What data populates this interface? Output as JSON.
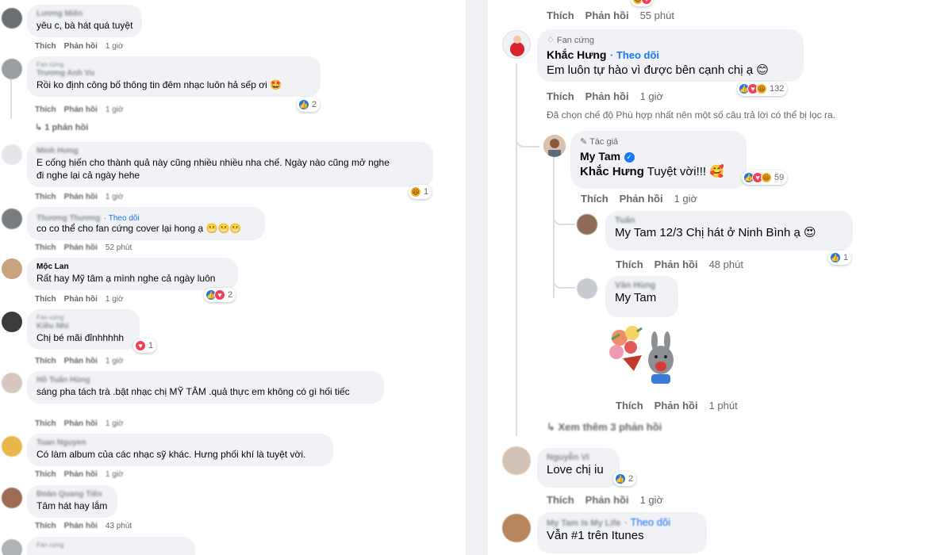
{
  "left": {
    "comments": [
      {
        "name": "Lương Miên",
        "text": "yêu c, bà hát quá tuyệt",
        "like": "Thích",
        "reply": "Phản hồi",
        "time": "1 giờ"
      },
      {
        "badge": "Fan cứng",
        "name": "Trương Anh Vu",
        "text": "Rồi ko định công bố thông tin đêm nhạc luôn hả sếp ơi 🤩",
        "reactions": "2",
        "like": "Thích",
        "reply": "Phản hồi",
        "time": "1 giờ",
        "replies": "1 phản hồi"
      },
      {
        "name": "Minh Hưng",
        "text_line1": "E cống hiến cho thành quả này cũng nhiều nhiều nha chế. Ngày nào cũng mở nghe",
        "text_line2": "đi nghe lại cả ngày hehe",
        "reactions": "1",
        "like": "Thích",
        "reply": "Phản hồi",
        "time": "1 giờ"
      },
      {
        "name": "Thương Thương",
        "follow": "Theo dõi",
        "text": "co co thể cho fan cứng cover lại hong ạ 😬😬😬",
        "like": "Thích",
        "reply": "Phản hồi",
        "time": "52 phút"
      },
      {
        "name": "Mộc Lan",
        "text": "Rất hay Mỹ tâm ạ mình nghe cả ngày luôn",
        "reactions": "2",
        "like": "Thích",
        "reply": "Phản hồi",
        "time": "1 giờ"
      },
      {
        "badge": "Fan cứng",
        "name": "Kiều Nhi",
        "text": "Chị bé mãi đỉnhhhhh",
        "reactions": "1",
        "like": "Thích",
        "reply": "Phản hồi",
        "time": "1 giờ"
      },
      {
        "name": "Hồ Tuấn Hùng",
        "text": "sáng pha tách trà .bật nhạc chị MỸ TÂM .quả thực em không có gì hối tiếc",
        "like": "Thích",
        "reply": "Phản hồi",
        "time": "1 giờ"
      },
      {
        "name": "Tuan Nguyen",
        "text": "Có làm album của các nhạc sỹ khác. Hưng phối khí là tuyệt vời.",
        "like": "Thích",
        "reply": "Phản hồi",
        "time": "1 giờ"
      },
      {
        "name": "Đoàn Quang Tiến",
        "text": "Tâm hát hay lắm",
        "like": "Thích",
        "reply": "Phản hồi",
        "time": "43 phút"
      },
      {
        "badge": "Fan cứng"
      }
    ]
  },
  "right": {
    "top_actions": {
      "like": "Thích",
      "reply": "Phản hồi",
      "time": "55 phút"
    },
    "main_comment": {
      "badge": "Fan cứng",
      "name": "Khắc Hưng",
      "follow": "Theo dõi",
      "text": "Em luôn tự hào vì được bên cạnh chị ạ 😊",
      "reactions": "132",
      "like": "Thích",
      "reply": "Phản hồi",
      "time": "1 giờ"
    },
    "filter_note": "Đã chọn chế độ Phù hợp nhất nên một số câu trả lời có thể bị lọc ra.",
    "author_reply": {
      "badge": "Tác giả",
      "name": "My Tam",
      "mention": "Khắc Hưng",
      "text": "Tuyệt vời!!! 🥰",
      "reactions": "59",
      "like": "Thích",
      "reply": "Phản hồi",
      "time": "1 giờ"
    },
    "reply_tuan": {
      "name": "Tuấn",
      "mention": "My Tam",
      "text": "12/3 Chị hát ở Ninh Bình ạ 😍",
      "reactions": "1",
      "like": "Thích",
      "reply": "Phản hồi",
      "time": "48 phút"
    },
    "reply_van": {
      "name": "Văn Hùng",
      "mention": "My Tam",
      "like": "Thích",
      "reply": "Phản hồi",
      "time": "1 phút"
    },
    "more_replies": "Xem thêm 3 phản hồi",
    "comment_vi": {
      "name": "Nguyễn Vi",
      "text": "Love chị iu",
      "reactions": "2",
      "like": "Thích",
      "reply": "Phản hồi",
      "time": "1 giờ"
    },
    "comment_last": {
      "name": "My Tam Is My Life",
      "follow": "Theo dõi",
      "text": "Vẫn #1 trên Itunes"
    }
  }
}
